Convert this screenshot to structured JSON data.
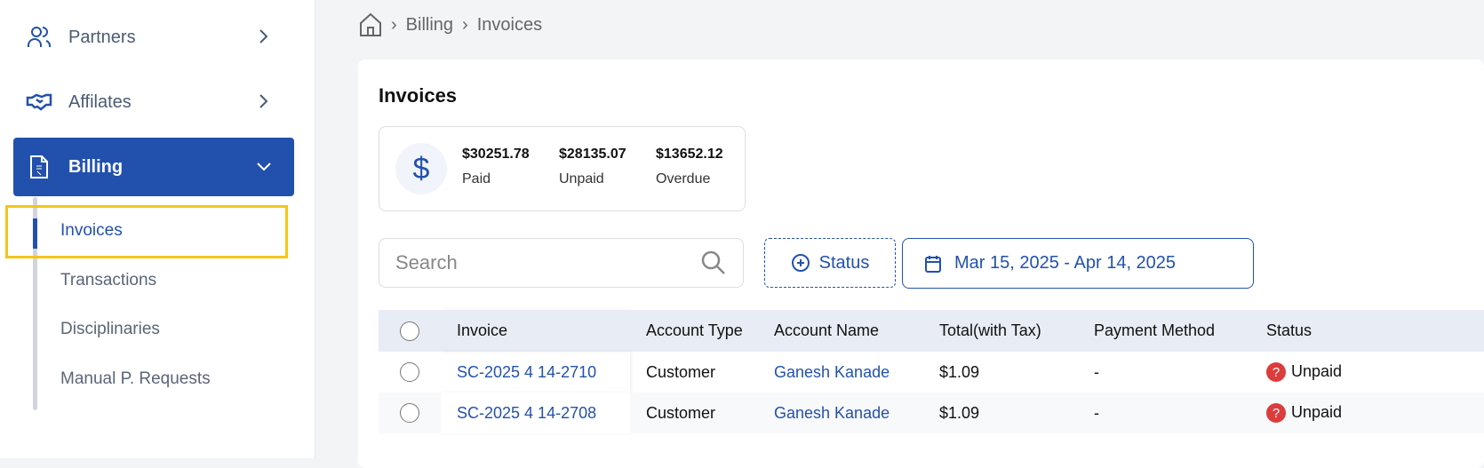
{
  "sidebar": {
    "items": [
      {
        "label": "Partners",
        "icon": "users-icon"
      },
      {
        "label": "Affilates",
        "icon": "handshake-icon"
      },
      {
        "label": "Billing",
        "icon": "invoice-file-icon"
      }
    ],
    "sub_items": [
      "Invoices",
      "Transactions",
      "Disciplinaries",
      "Manual P. Requests"
    ]
  },
  "breadcrumb": [
    "Billing",
    "Invoices"
  ],
  "page": {
    "title": "Invoices",
    "stats": [
      {
        "value": "$30251.78",
        "label": "Paid"
      },
      {
        "value": "$28135.07",
        "label": "Unpaid"
      },
      {
        "value": "$13652.12",
        "label": "Overdue"
      }
    ],
    "search_placeholder": "Search",
    "status_label": "Status",
    "date_range": "Mar 15, 2025 - Apr 14, 2025"
  },
  "table": {
    "headers": [
      "Invoice",
      "Account Type",
      "Account Name",
      "Total(with Tax)",
      "Payment Method",
      "Status"
    ],
    "rows": [
      [
        "SC-2025 4 14-2710",
        "Customer",
        "Ganesh Kanade",
        "$1.09",
        "-",
        "Unpaid"
      ],
      [
        "SC-2025 4 14-2708",
        "Customer",
        "Ganesh Kanade",
        "$1.09",
        "-",
        "Unpaid"
      ]
    ]
  },
  "colors": {
    "accent": "#2251ad",
    "highlight": "#f5c518",
    "unpaid": "#dc3c3c"
  }
}
